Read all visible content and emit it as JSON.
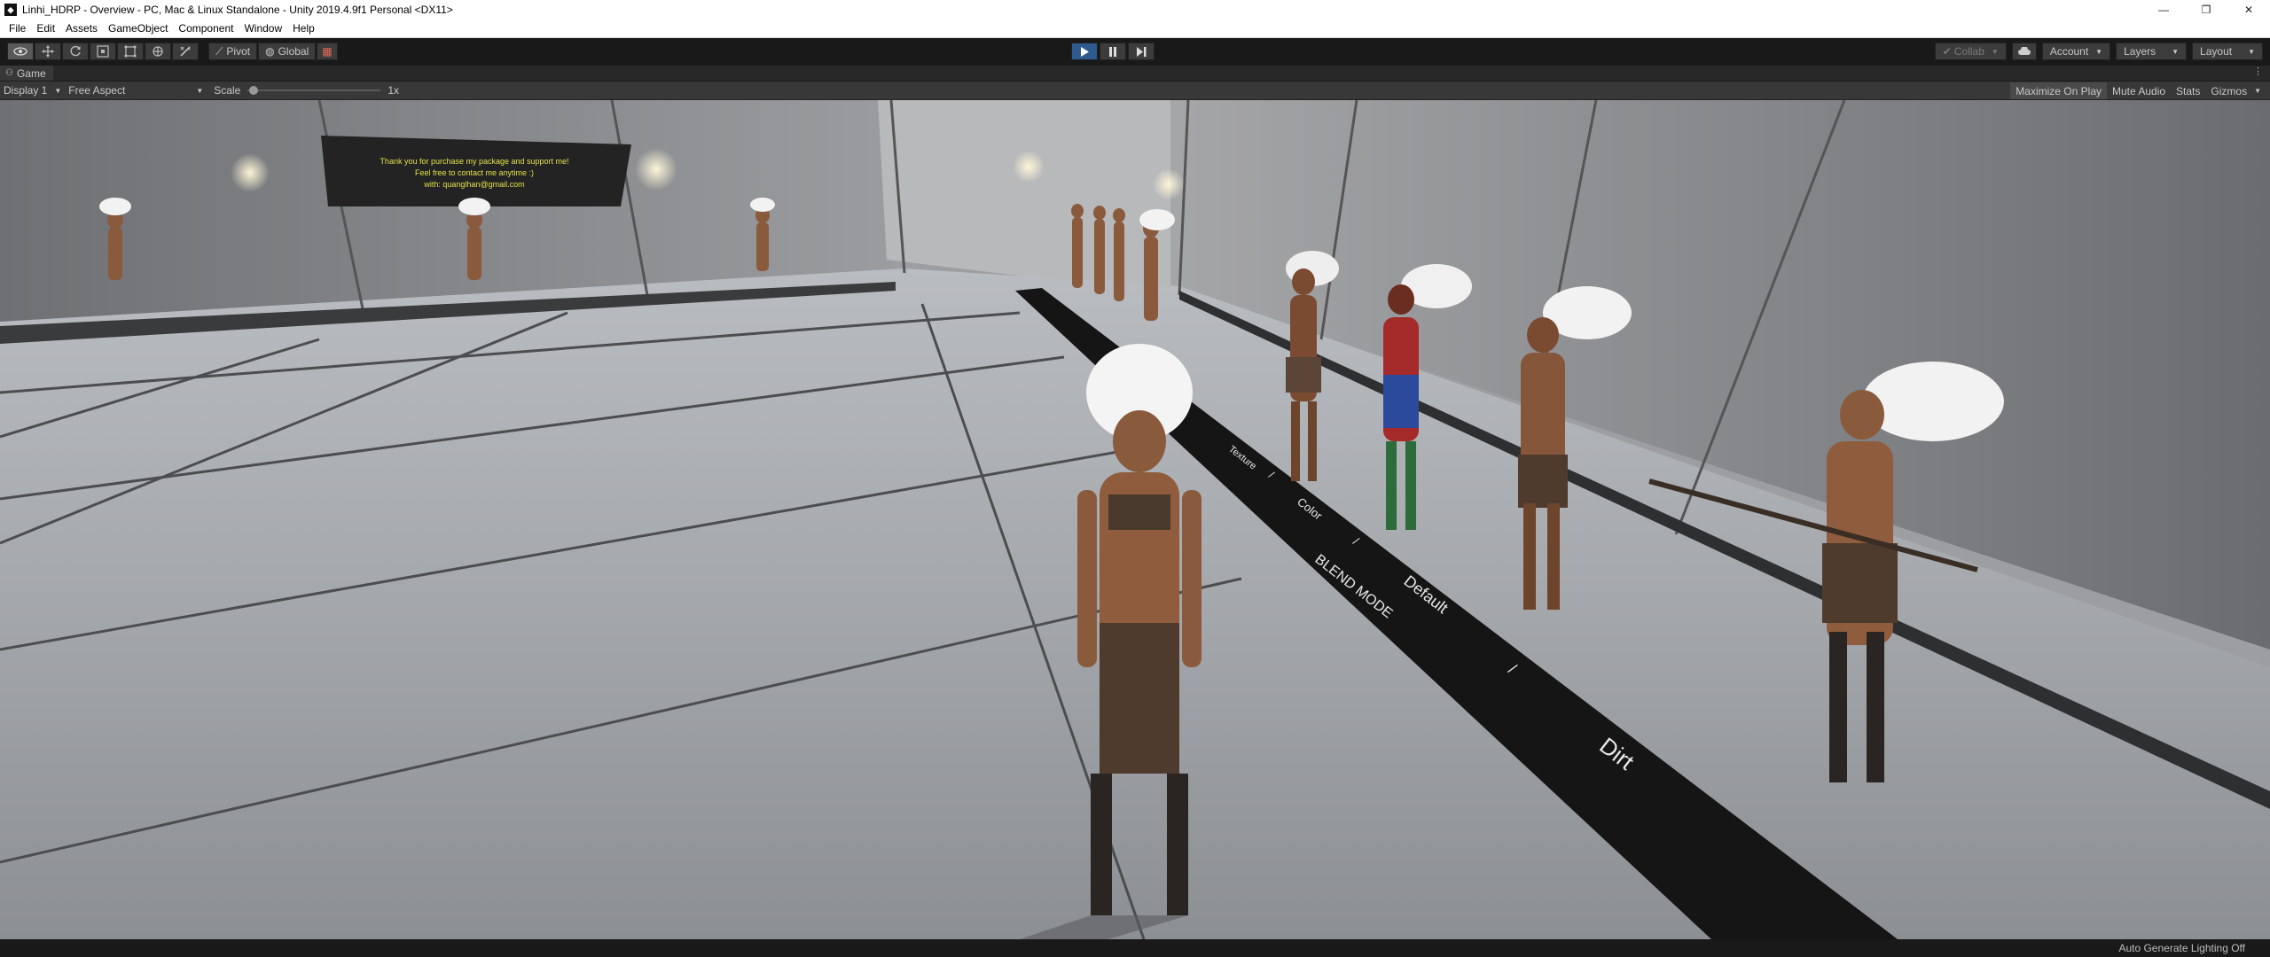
{
  "window": {
    "title": "Linhi_HDRP - Overview - PC, Mac & Linux Standalone - Unity 2019.4.9f1 Personal <DX11>",
    "controls": [
      "—",
      "❐",
      "✕"
    ]
  },
  "menu": [
    "File",
    "Edit",
    "Assets",
    "GameObject",
    "Component",
    "Window",
    "Help"
  ],
  "toolbar": {
    "pivot": "Pivot",
    "global": "Global",
    "collab": "Collab",
    "account": "Account",
    "layers": "Layers",
    "layout": "Layout"
  },
  "tab": {
    "label": "Game"
  },
  "gamebar": {
    "display": "Display 1",
    "aspect": "Free Aspect",
    "scale_label": "Scale",
    "scale_value": "1x",
    "scale_fraction": 0.0,
    "maximize": "Maximize On Play",
    "mute": "Mute Audio",
    "stats": "Stats",
    "gizmos": "Gizmos"
  },
  "scene": {
    "sign_lines": [
      "Thank you for purchase my package and support me!",
      "Feel free to contact me anytime :)",
      "with: quanglhan@gmail.com"
    ],
    "floor_labels": [
      "Texture",
      "/",
      "Color",
      "/",
      "BLEND MODE",
      "Default",
      "/",
      "Dirt"
    ]
  },
  "status": {
    "text": "Auto Generate Lighting Off"
  },
  "colors": {
    "play_active": "#2f5a8e",
    "editor_bg": "#191919"
  }
}
